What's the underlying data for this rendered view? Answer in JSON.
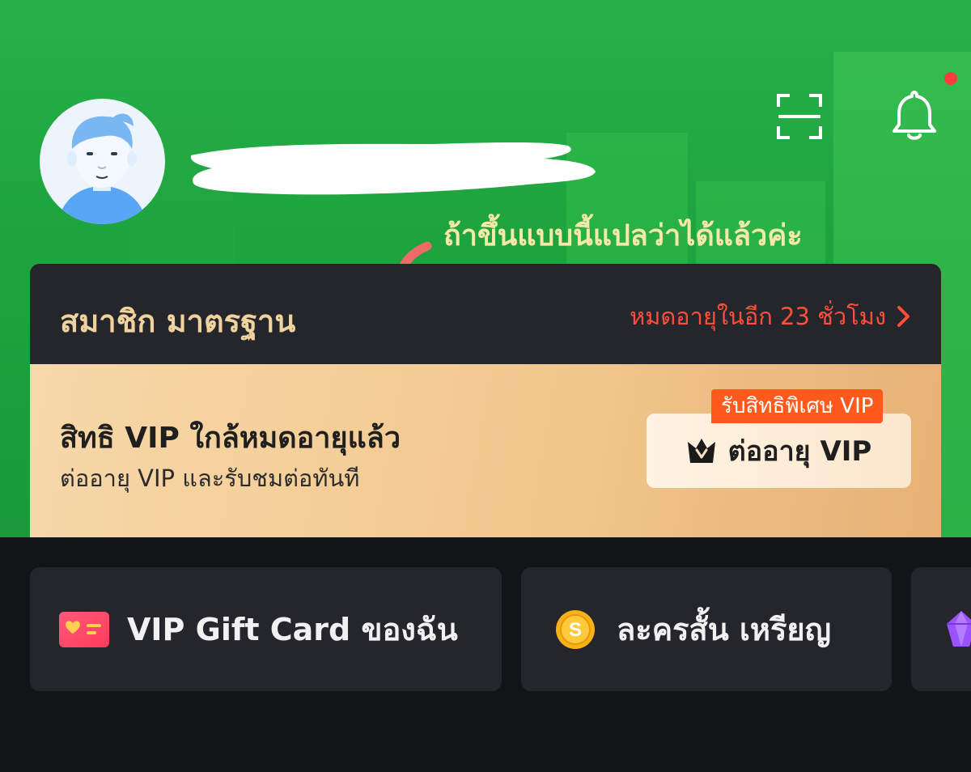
{
  "header": {
    "scan_icon": "scan-icon",
    "bell_icon": "bell-icon",
    "notification_dot_color": "#ff3b3b",
    "username_redacted": true
  },
  "annotation": {
    "text": "ถ้าขึ้นแบบนี้แปลว่าได้แล้วค่ะ",
    "arrow_color": "#f06a6a"
  },
  "membership": {
    "title": "สมาชิก มาตรฐาน",
    "expiry_text": "หมดอายุในอีก 23 ชั่วโมง",
    "expiry_color": "#ff4f3b"
  },
  "vip": {
    "title": "สิทธิ VIP ใกล้หมดอายุแล้ว",
    "subtitle": "ต่ออายุ VIP และรับชมต่อทันที",
    "promo_badge": "รับสิทธิพิเศษ VIP",
    "renew_button": "ต่ออายุ VIP"
  },
  "tiles": [
    {
      "label": "VIP Gift Card ของฉัน",
      "icon": "gift-card-icon"
    },
    {
      "label": "ละครสั้น เหรียญ",
      "icon": "coin-icon"
    },
    {
      "label": "",
      "icon": "gem-icon"
    }
  ]
}
